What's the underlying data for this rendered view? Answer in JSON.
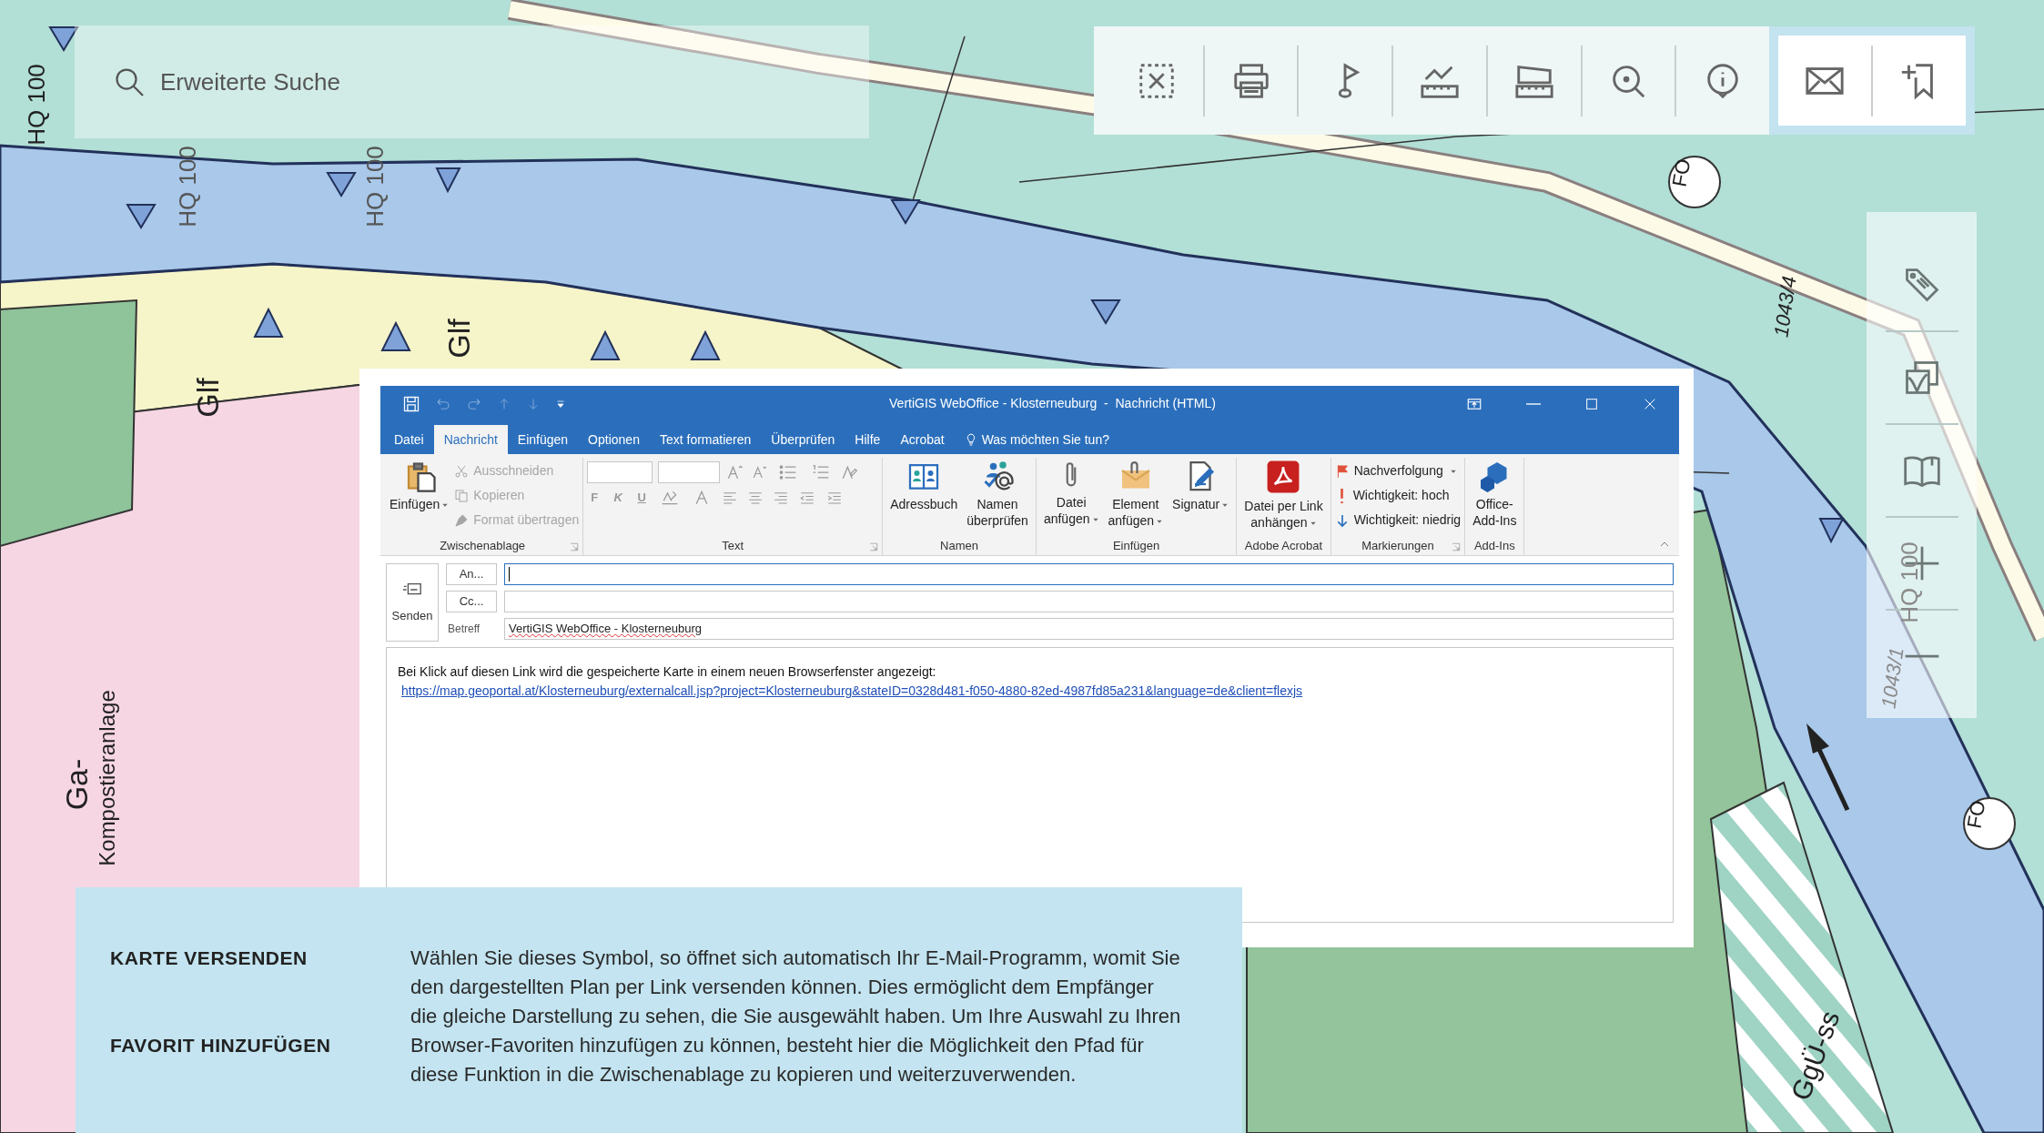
{
  "map": {
    "labels": [
      {
        "text": "HQ 100"
      },
      {
        "text": "HQ 100"
      },
      {
        "text": "HQ 100"
      },
      {
        "text": "Glf"
      },
      {
        "text": "Glf"
      },
      {
        "text": "Ga-"
      },
      {
        "text": "Kompostieranlage"
      },
      {
        "text": "1043/4"
      },
      {
        "text": "FO"
      },
      {
        "text": "FO"
      },
      {
        "text": "GgÜ-ss"
      },
      {
        "text": "HQ 100"
      },
      {
        "text": "1043/1"
      }
    ]
  },
  "search": {
    "placeholder": "Erweiterte Suche"
  },
  "toolbar": {
    "tools": [
      {
        "kind": "clear",
        "selected": false
      },
      {
        "kind": "print",
        "selected": false
      },
      {
        "kind": "flag",
        "selected": false
      },
      {
        "kind": "profile",
        "selected": false
      },
      {
        "kind": "area",
        "selected": false
      },
      {
        "kind": "zoom",
        "selected": false
      },
      {
        "kind": "info",
        "selected": false
      },
      {
        "kind": "mail",
        "selected": true
      },
      {
        "kind": "bookmark",
        "selected": true
      }
    ]
  },
  "side_toolbar": {
    "tools": [
      {
        "kind": "tag"
      },
      {
        "kind": "layers"
      },
      {
        "kind": "book"
      },
      {
        "kind": "zoom_in"
      },
      {
        "kind": "zoom_out"
      }
    ]
  },
  "mail_window": {
    "title": "VertiGIS WebOffice - Klosterneuburg  -  Nachricht (HTML)",
    "tabs": [
      {
        "label": "Datei",
        "selected": false
      },
      {
        "label": "Nachricht",
        "selected": true
      },
      {
        "label": "Einfügen",
        "selected": false
      },
      {
        "label": "Optionen",
        "selected": false
      },
      {
        "label": "Text formatieren",
        "selected": false
      },
      {
        "label": "Überprüfen",
        "selected": false
      },
      {
        "label": "Hilfe",
        "selected": false
      },
      {
        "label": "Acrobat",
        "selected": false
      }
    ],
    "tell_me": "Was möchten Sie tun?",
    "ribbon": [
      {
        "label": "Zwischenablage",
        "items": [
          {
            "kind": "large",
            "lines": [
              "Einfügen"
            ],
            "dropdown": true
          },
          {
            "kind": "small",
            "label": "Ausschneiden",
            "disabled": true
          },
          {
            "kind": "small",
            "label": "Kopieren",
            "disabled": true
          },
          {
            "kind": "small",
            "label": "Format übertragen",
            "disabled": true
          }
        ]
      },
      {
        "label": "Text",
        "items": [
          {
            "kind": "format",
            "letters": [
              "F",
              "K",
              "U"
            ]
          }
        ]
      },
      {
        "label": "Namen",
        "items": [
          {
            "kind": "large",
            "lines": [
              "Adressbuch"
            ],
            "dropdown": false
          },
          {
            "kind": "large",
            "lines": [
              "Namen",
              "überprüfen"
            ],
            "dropdown": false
          }
        ]
      },
      {
        "label": "Einfügen",
        "items": [
          {
            "kind": "large",
            "lines": [
              "Datei",
              "anfügen"
            ],
            "dropdown": true
          },
          {
            "kind": "large",
            "lines": [
              "Element",
              "anfügen"
            ],
            "dropdown": true
          },
          {
            "kind": "large",
            "lines": [
              "Signatur"
            ],
            "dropdown": true
          }
        ]
      },
      {
        "label": "Adobe Acrobat",
        "items": [
          {
            "kind": "large",
            "lines": [
              "Datei per Link",
              "anhängen"
            ],
            "dropdown": true
          }
        ]
      },
      {
        "label": "Markierungen",
        "items": [
          {
            "kind": "small",
            "label": "Nachverfolgung",
            "disabled": false,
            "dropdown": true
          },
          {
            "kind": "small",
            "label": "Wichtigkeit: hoch",
            "disabled": false,
            "dropdown": false
          },
          {
            "kind": "small",
            "label": "Wichtigkeit: niedrig",
            "disabled": false,
            "dropdown": false
          }
        ]
      },
      {
        "label": "Add-Ins",
        "items": [
          {
            "kind": "large",
            "lines": [
              "Office-",
              "Add-Ins"
            ],
            "dropdown": false
          }
        ]
      }
    ],
    "send": "Senden",
    "to": "An...",
    "cc": "Cc...",
    "subject_label": "Betreff",
    "subject": "VertiGIS WebOffice - Klosterneuburg",
    "body": "Bei Klick auf diesen Link wird die gespeicherte Karte in einem neuen Browserfenster angezeigt:",
    "link": "https://map.geoportal.at/Klosterneuburg/externalcall.jsp?project=Klosterneuburg&stateID=0328d481-f050-4880-82ed-4987fd85a231&language=de&client=flexjs"
  },
  "info_panel": {
    "headings": [
      "KARTE VERSENDEN",
      "FAVORIT HINZUFÜGEN"
    ],
    "text": "Wählen Sie dieses Symbol, so öffnet sich automatisch Ihr E-Mail-Programm, womit Sie den dargestellten Plan per Link versenden können. Dies ermöglicht dem Empfänger die gleiche Darstellung zu sehen, die Sie ausgewählt haben. Um Ihre Auswahl zu Ihren Browser-Favoriten hinzufügen zu können, besteht hier die Möglichkeit den Pfad für diese Funktion in die Zwischenablage zu kopieren und weiterzuverwenden."
  }
}
